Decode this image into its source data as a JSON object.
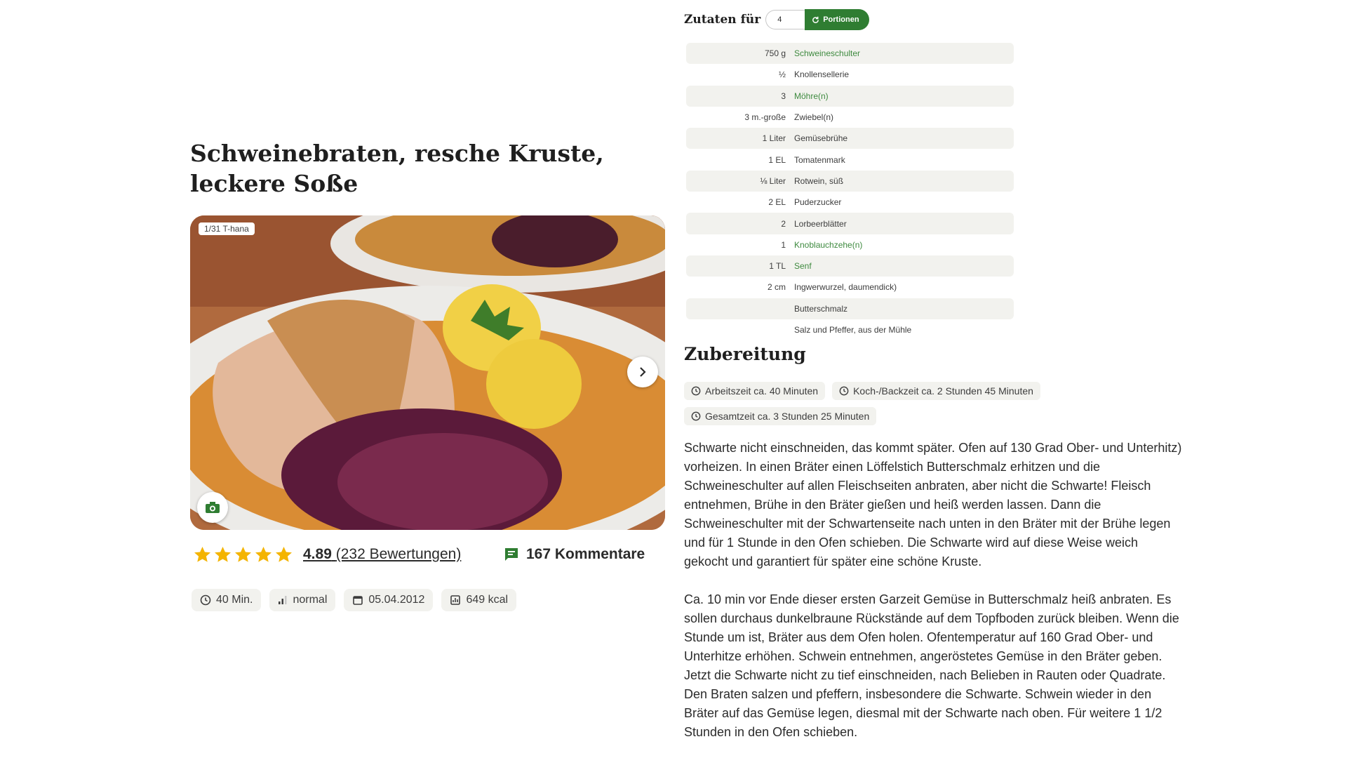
{
  "recipe": {
    "title": "Schweinebraten, resche Kruste, leckere Soße",
    "image_counter": "1/31 T-hana",
    "rating": {
      "value": "4.89",
      "count_label": "(232 Bewertungen)",
      "stars": 5
    },
    "comments_label": "167 Kommentare",
    "meta": [
      {
        "icon": "clock-icon",
        "label": "40 Min."
      },
      {
        "icon": "difficulty-icon",
        "label": "normal"
      },
      {
        "icon": "calendar-icon",
        "label": "05.04.2012"
      },
      {
        "icon": "calories-icon",
        "label": "649 kcal"
      }
    ]
  },
  "servings": {
    "label": "Zutaten für",
    "value": "4",
    "button_label": "Portionen"
  },
  "ingredients": [
    {
      "amount": "750 g",
      "name": "Schweineschulter",
      "link": true
    },
    {
      "amount": "½",
      "name": "Knollensellerie",
      "link": false
    },
    {
      "amount": "3",
      "name": "Möhre(n)",
      "link": true
    },
    {
      "amount": "3 m.-große",
      "name": "Zwiebel(n)",
      "link": false
    },
    {
      "amount": "1 Liter",
      "name": "Gemüsebrühe",
      "link": false
    },
    {
      "amount": "1 EL",
      "name": "Tomatenmark",
      "link": false
    },
    {
      "amount": "⅛ Liter",
      "name": "Rotwein, süß",
      "link": false
    },
    {
      "amount": "2 EL",
      "name": "Puderzucker",
      "link": false
    },
    {
      "amount": "2",
      "name": "Lorbeerblätter",
      "link": false
    },
    {
      "amount": "1",
      "name": "Knoblauchzehe(n)",
      "link": true
    },
    {
      "amount": "1 TL",
      "name": "Senf",
      "link": true
    },
    {
      "amount": "2 cm",
      "name": "Ingwerwurzel, daumendick)",
      "link": false
    },
    {
      "amount": "",
      "name": "Butterschmalz",
      "link": false
    },
    {
      "amount": "",
      "name": "Salz und Pfeffer, aus der Mühle",
      "link": false
    }
  ],
  "preparation": {
    "title": "Zubereitung",
    "times": [
      "Arbeitszeit ca. 40 Minuten",
      "Koch-/Backzeit ca. 2 Stunden 45 Minuten",
      "Gesamtzeit ca. 3 Stunden 25 Minuten"
    ],
    "paragraphs": [
      "Schwarte nicht einschneiden, das kommt später. Ofen auf 130 Grad Ober- und Unterhitz) vorheizen. In einen Bräter einen Löffelstich Butterschmalz erhitzen und die Schweineschulter auf allen Fleischseiten anbraten, aber nicht die Schwarte! Fleisch entnehmen, Brühe in den Bräter gießen und heiß werden lassen. Dann die Schweineschulter mit der Schwartenseite nach unten in den Bräter mit der Brühe legen und für 1 Stunde in den Ofen schieben. Die Schwarte wird auf diese Weise weich gekocht und garantiert für später eine schöne Kruste.",
      "Ca. 10 min vor Ende dieser ersten Garzeit Gemüse in Butterschmalz heiß anbraten. Es sollen durchaus dunkelbraune Rückstände auf dem Topfboden zurück bleiben. Wenn die Stunde um ist, Bräter aus dem Ofen holen. Ofentemperatur auf 160 Grad Ober- und Unterhitze erhöhen. Schwein entnehmen, angeröstetes Gemüse in den Bräter geben.\nJetzt die Schwarte nicht zu tief einschneiden, nach Belieben in Rauten oder Quadrate. Den Braten salzen und pfeffern, insbesondere die Schwarte. Schwein wieder in den Bräter auf das Gemüse legen, diesmal mit der Schwarte nach oben. Für weitere 1 1/2 Stunden in den Ofen schieben."
    ]
  },
  "colors": {
    "accent": "#2f7d32",
    "link": "#3e8a3f",
    "star": "#f4b400",
    "chip_bg": "#f2f2ee"
  }
}
